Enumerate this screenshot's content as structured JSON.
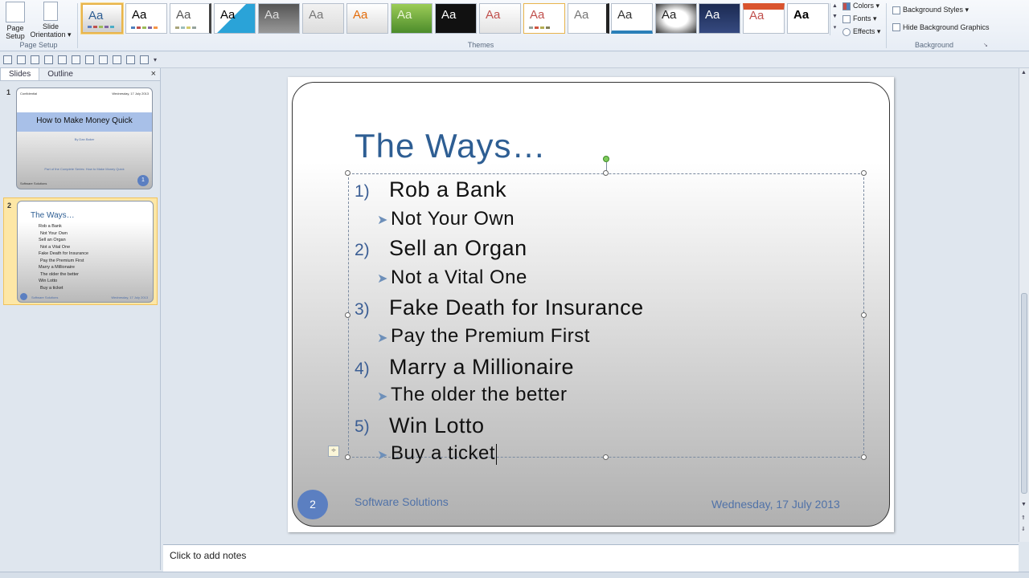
{
  "ribbon": {
    "page_setup": {
      "button1": "Page Setup",
      "button2": "Slide Orientation ▾",
      "group_label": "Page Setup"
    },
    "themes": {
      "group_label": "Themes",
      "tile_label": "Aa"
    },
    "theme_commands": {
      "colors": "Colors ▾",
      "fonts": "Fonts ▾",
      "effects": "Effects ▾"
    },
    "background": {
      "styles": "Background Styles ▾",
      "hide_graphics": "Hide Background Graphics",
      "group_label": "Background"
    }
  },
  "slides_pane": {
    "tabs": [
      "Slides",
      "Outline"
    ],
    "close_icon": "×",
    "thumb1": {
      "number": "1",
      "top_left": "Confidential",
      "top_right": "Wednesday, 17 July 2013",
      "title": "How to Make Money Quick",
      "byline": "By Dan Baker",
      "series": "Part of the Complete Series: How to Make Money Quick",
      "footer": "Software Solutions",
      "badge": "1"
    },
    "thumb2": {
      "number": "2",
      "title": "The Ways…",
      "lines": [
        "Rob a Bank",
        "Not Your Own",
        "Sell an Organ",
        "Not a Vital One",
        "Fake Death for Insurance",
        "Pay the Premium First",
        "Marry a Millionaire",
        "The older the better",
        "Win Lotto",
        "Buy a ticket"
      ],
      "footer": "Software Solutions",
      "date": "Wednesday, 17 July 2013"
    }
  },
  "slide": {
    "title": "The Ways…",
    "items": [
      {
        "num": "1)",
        "text": "Rob a Bank",
        "sub": "Not Your Own"
      },
      {
        "num": "2)",
        "text": "Sell an Organ",
        "sub": "Not a Vital One"
      },
      {
        "num": "3)",
        "text": "Fake Death for Insurance",
        "sub": "Pay the Premium First"
      },
      {
        "num": "4)",
        "text": "Marry a Millionaire",
        "sub": "The older the better"
      },
      {
        "num": "5)",
        "text": "Win Lotto",
        "sub": "Buy a ticket"
      }
    ],
    "slide_number": "2",
    "footer": "Software Solutions",
    "date": "Wednesday,  17 July 2013"
  },
  "notes": {
    "placeholder": "Click to add notes"
  },
  "colors": {
    "accent": "#2e5e93",
    "selection": "#f1c35d",
    "number_badge": "#5b7fc1"
  }
}
